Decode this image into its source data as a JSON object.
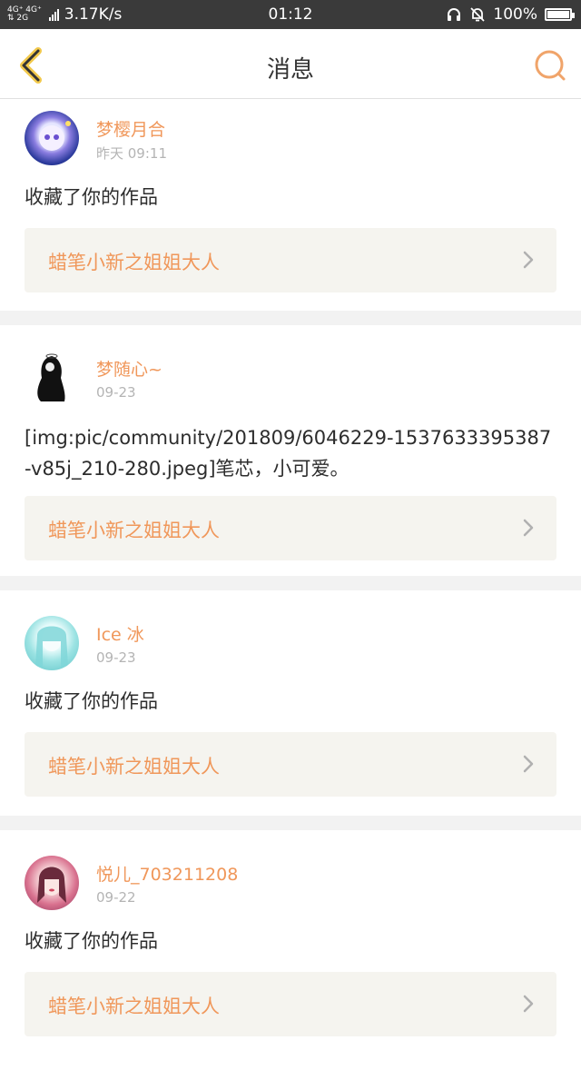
{
  "status_bar": {
    "net_top": "4G⁺ 4G⁺",
    "net_bottom": "⇅ 2G",
    "speed": "3.17K/s",
    "time": "01:12",
    "battery": "100%",
    "battery_level": 1.0
  },
  "header": {
    "title": "消息",
    "back_icon": "chevron-left-icon",
    "search_icon": "search-icon",
    "accent_color": "#f0a46a"
  },
  "messages": [
    {
      "user": "梦樱月合",
      "time": "昨天 09:11",
      "content": "收藏了你的作品",
      "work_title": "蜡笔小新之姐姐大人"
    },
    {
      "user": "梦随心~",
      "time": "09-23",
      "content": "[img:pic/community/201809/6046229-1537633395387-v85j_210-280.jpeg]笔芯，小可爱。",
      "work_title": "蜡笔小新之姐姐大人"
    },
    {
      "user": "Ice 冰",
      "time": "09-23",
      "content": "收藏了你的作品",
      "work_title": "蜡笔小新之姐姐大人"
    },
    {
      "user": "悦儿_703211208",
      "time": "09-22",
      "content": "收藏了你的作品",
      "work_title": "蜡笔小新之姐姐大人"
    }
  ],
  "colors": {
    "username": "#f0975a",
    "work_title": "#f0975a",
    "time": "#b4b4b4",
    "background": "#f2f2f2",
    "work_bg": "#f5f4ef"
  }
}
